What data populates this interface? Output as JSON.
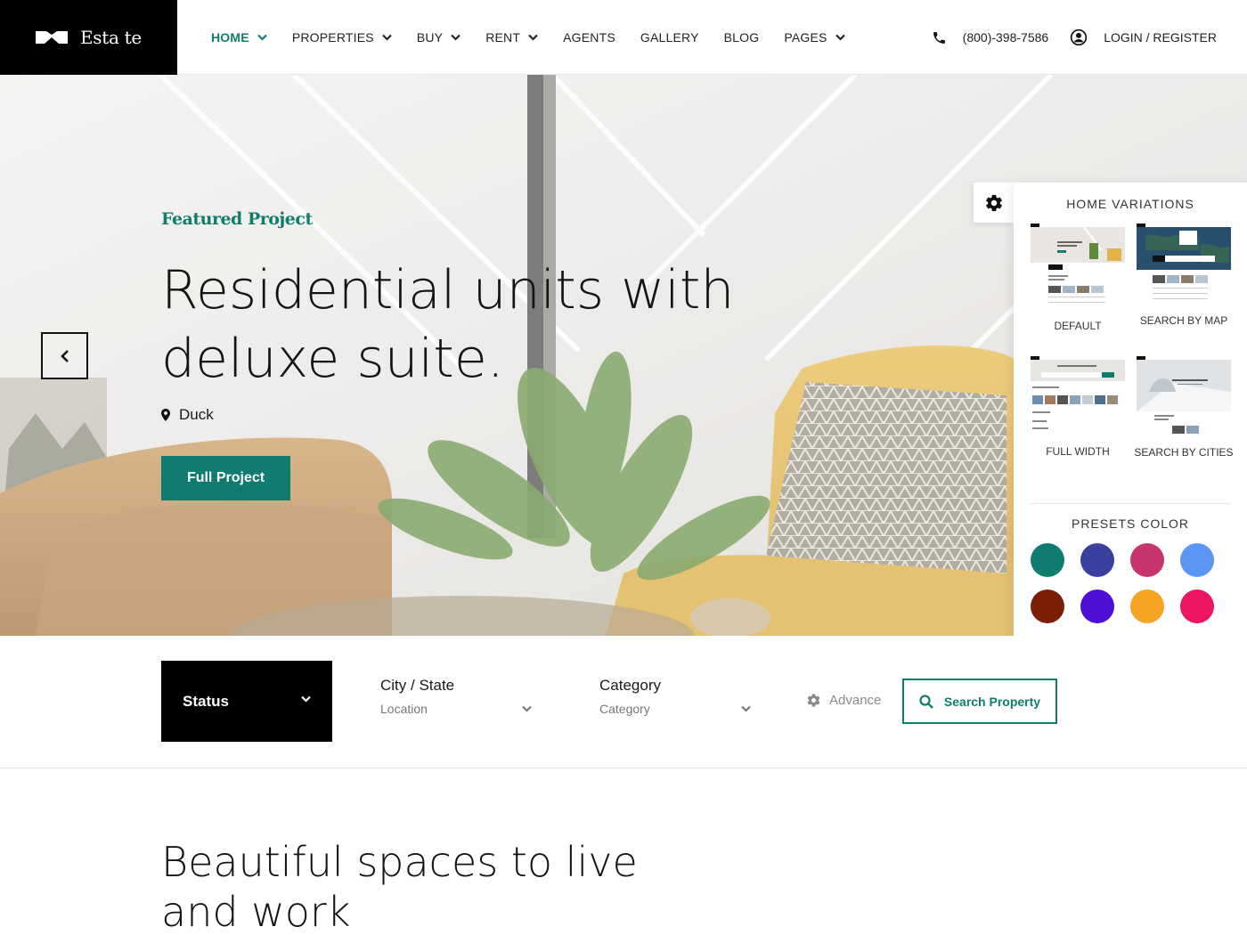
{
  "brand": {
    "name": "Esta te"
  },
  "nav": {
    "items": [
      {
        "label": "HOME",
        "has_dropdown": true,
        "active": true
      },
      {
        "label": "PROPERTIES",
        "has_dropdown": true
      },
      {
        "label": "BUY",
        "has_dropdown": true
      },
      {
        "label": "RENT",
        "has_dropdown": true
      },
      {
        "label": "AGENTS"
      },
      {
        "label": "GALLERY"
      },
      {
        "label": "BLOG"
      },
      {
        "label": "PAGES",
        "has_dropdown": true
      }
    ],
    "phone": "(800)-398-7586",
    "login": "LOGIN / REGISTER"
  },
  "hero": {
    "featured": "Featured Project",
    "headline": "Residential units with deluxe suite.",
    "location": "Duck",
    "button": "Full Project"
  },
  "panel": {
    "variations_title": "HOME VARIATIONS",
    "variations": [
      {
        "label": "DEFAULT"
      },
      {
        "label": "SEARCH BY MAP"
      },
      {
        "label": "FULL WIDTH"
      },
      {
        "label": "SEARCH BY CITIES"
      }
    ],
    "presets_title": "PRESETS COLOR",
    "presets": [
      "#0e7c6f",
      "#3b3f9e",
      "#c73570",
      "#5b95f5",
      "#7a1f05",
      "#4d0fd6",
      "#f3a423",
      "#ec1463"
    ]
  },
  "search": {
    "status_label": "Status",
    "city_label": "City / State",
    "city_placeholder": "Location",
    "category_label": "Category",
    "category_placeholder": "Category",
    "advance": "Advance",
    "button": "Search Property"
  },
  "section": {
    "title": "Beautiful spaces to live and work"
  },
  "colors": {
    "accent": "#0e7c6f",
    "dark": "#000000"
  }
}
